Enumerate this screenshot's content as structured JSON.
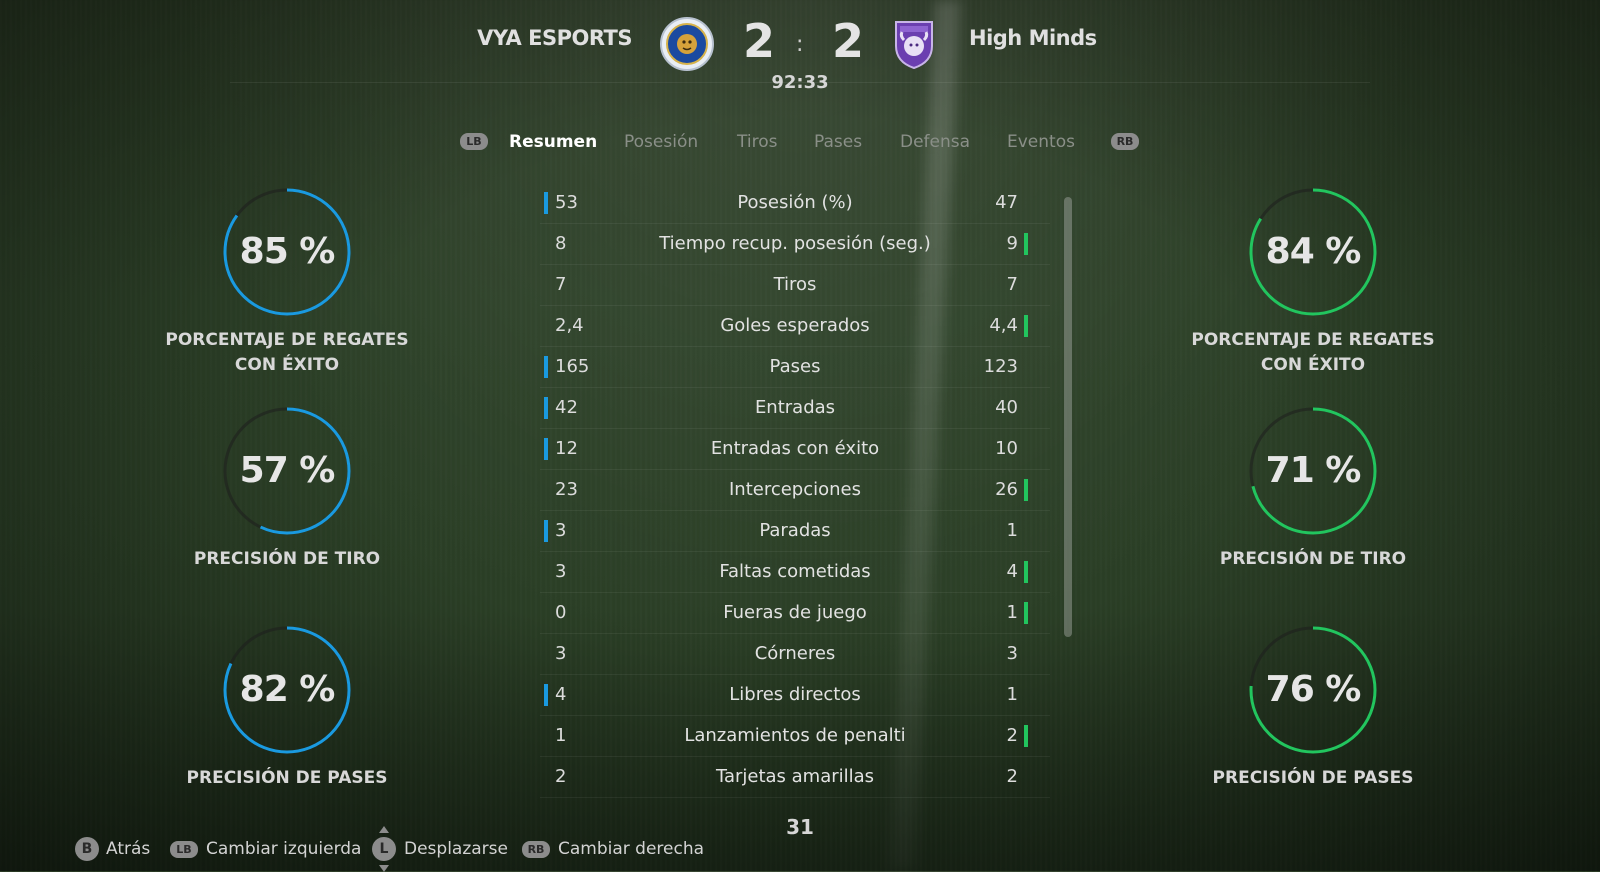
{
  "match": {
    "home_team": "VYA ESPORTS",
    "away_team": "High Minds",
    "home_score": "2",
    "away_score": "2",
    "separator": ":",
    "clock": "92:33",
    "home_crest_icon": "lion-crest-icon",
    "away_crest_icon": "bull-crest-icon",
    "home_color": "#1a9ae0",
    "away_color": "#22c55e"
  },
  "tabs": {
    "left_bumper": "LB",
    "right_bumper": "RB",
    "items": [
      "Resumen",
      "Posesión",
      "Tiros",
      "Pases",
      "Defensa",
      "Eventos"
    ],
    "active": "Resumen"
  },
  "home_gauges": [
    {
      "value": 85,
      "text": "85 %",
      "label": "PORCENTAJE DE REGATES CON ÉXITO"
    },
    {
      "value": 57,
      "text": "57 %",
      "label": "PRECISIÓN DE TIRO"
    },
    {
      "value": 82,
      "text": "82 %",
      "label": "PRECISIÓN DE PASES"
    }
  ],
  "away_gauges": [
    {
      "value": 84,
      "text": "84 %",
      "label": "PORCENTAJE DE REGATES CON ÉXITO"
    },
    {
      "value": 71,
      "text": "71 %",
      "label": "PRECISIÓN DE TIRO"
    },
    {
      "value": 76,
      "text": "76 %",
      "label": "PRECISIÓN DE PASES"
    }
  ],
  "stats": [
    {
      "label": "Posesión (%)",
      "home": "53",
      "away": "47",
      "leader": "home"
    },
    {
      "label": "Tiempo recup. posesión (seg.)",
      "home": "8",
      "away": "9",
      "leader": "away"
    },
    {
      "label": "Tiros",
      "home": "7",
      "away": "7",
      "leader": "none"
    },
    {
      "label": "Goles esperados",
      "home": "2,4",
      "away": "4,4",
      "leader": "away"
    },
    {
      "label": "Pases",
      "home": "165",
      "away": "123",
      "leader": "home"
    },
    {
      "label": "Entradas",
      "home": "42",
      "away": "40",
      "leader": "home"
    },
    {
      "label": "Entradas con éxito",
      "home": "12",
      "away": "10",
      "leader": "home"
    },
    {
      "label": "Intercepciones",
      "home": "23",
      "away": "26",
      "leader": "away"
    },
    {
      "label": "Paradas",
      "home": "3",
      "away": "1",
      "leader": "home"
    },
    {
      "label": "Faltas cometidas",
      "home": "3",
      "away": "4",
      "leader": "away"
    },
    {
      "label": "Fueras de juego",
      "home": "0",
      "away": "1",
      "leader": "away"
    },
    {
      "label": "Córneres",
      "home": "3",
      "away": "3",
      "leader": "none"
    },
    {
      "label": "Libres directos",
      "home": "4",
      "away": "1",
      "leader": "home"
    },
    {
      "label": "Lanzamientos de penalti",
      "home": "1",
      "away": "2",
      "leader": "away"
    },
    {
      "label": "Tarjetas amarillas",
      "home": "2",
      "away": "2",
      "leader": "none"
    }
  ],
  "page_number": "31",
  "footer": {
    "back": {
      "key": "B",
      "label": "Atrás"
    },
    "switch_left": {
      "key": "LB",
      "label": "Cambiar izquierda"
    },
    "scroll": {
      "key": "L",
      "label": "Desplazarse"
    },
    "switch_right": {
      "key": "RB",
      "label": "Cambiar derecha"
    }
  }
}
